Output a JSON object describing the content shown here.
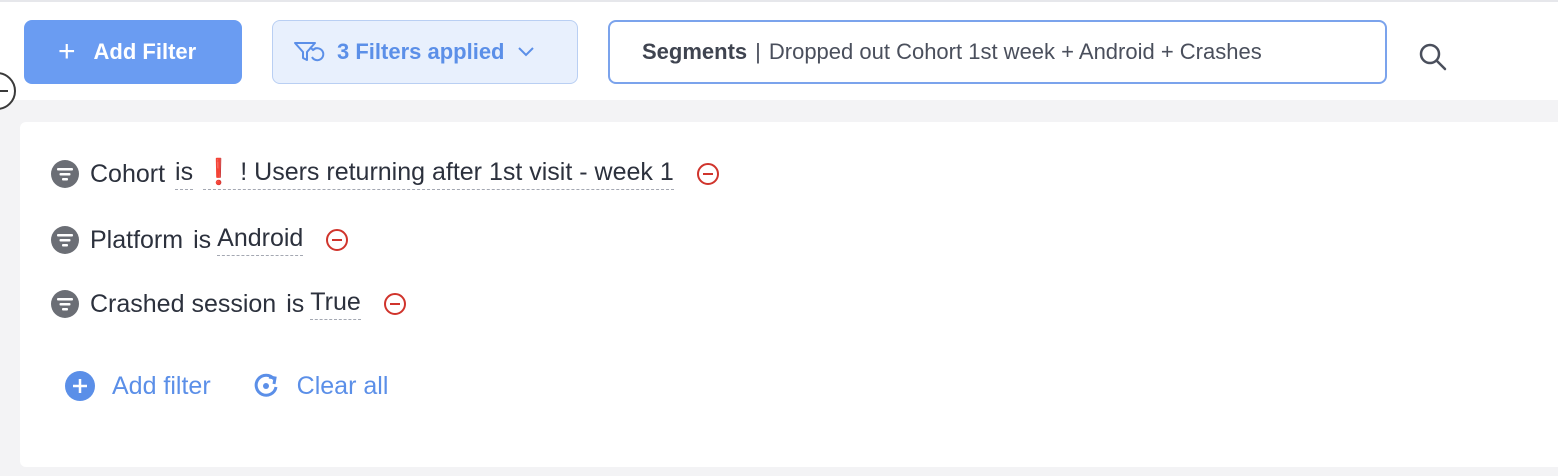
{
  "toolbar": {
    "add_filter_label": "Add Filter",
    "filters_applied_label": "3 Filters applied",
    "segments_label": "Segments",
    "segments_separator": "|",
    "segments_value": "Dropped out Cohort 1st week + Android + Crashes"
  },
  "filters": [
    {
      "field": "Cohort",
      "operator": "is",
      "value_prefix": "❗",
      "value": "! Users returning after 1st visit - week 1"
    },
    {
      "field": "Platform",
      "operator": "is",
      "value": "Android"
    },
    {
      "field": "Crashed session",
      "operator": "is",
      "value": "True"
    }
  ],
  "actions": {
    "add_filter_label": "Add filter",
    "clear_all_label": "Clear all"
  },
  "colors": {
    "accent": "#6a9cf2",
    "link": "#5b8fe8",
    "remove": "#d0342c",
    "filter_icon": "#6b6e75"
  },
  "icons": {
    "filter_row": "filter-funnel-icon",
    "remove": "minus-circle-icon",
    "search": "search-icon",
    "add": "plus-circle-icon",
    "clear": "refresh-icon"
  }
}
